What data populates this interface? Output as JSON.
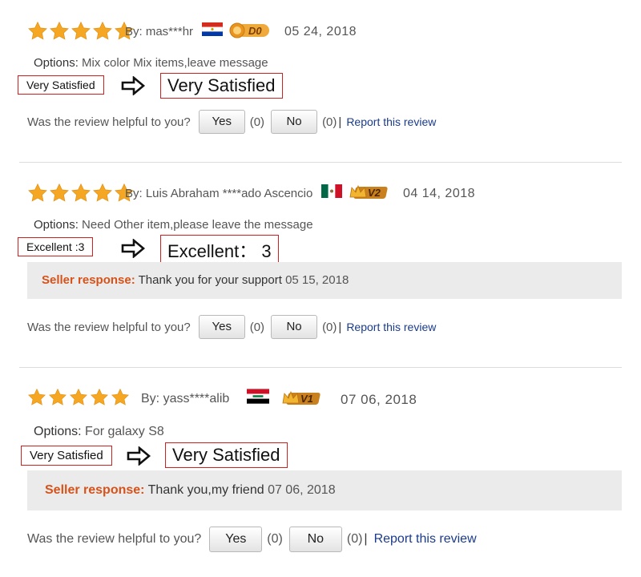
{
  "reviews": [
    {
      "rating": 5,
      "author": "By: mas***hr",
      "level": "D0",
      "date": "05 24, 2018",
      "options_label": "Options:",
      "options_value": "Mix color Mix items,leave message",
      "feedback_original": "Very Satisfied",
      "feedback_translated": "Very Satisfied",
      "helpful_question": "Was the review helpful to you?",
      "yes_label": "Yes",
      "yes_count": "(0)",
      "no_label": "No",
      "no_count": "(0)",
      "separator": "|",
      "report_label": "Report this review"
    },
    {
      "rating": 5,
      "author": "By: Luis Abraham ****ado Ascencio",
      "level": "V2",
      "date": "04 14, 2018",
      "options_label": "Options:",
      "options_value": "Need Other item,please leave the message",
      "feedback_original": "Excellent :3",
      "feedback_translated": "Excellent： 3",
      "seller_label": "Seller response:",
      "seller_text": "Thank you for your support",
      "seller_date": "05 15, 2018",
      "helpful_question": "Was the review helpful to you?",
      "yes_label": "Yes",
      "yes_count": "(0)",
      "no_label": "No",
      "no_count": "(0)",
      "separator": "|",
      "report_label": "Report this review"
    },
    {
      "rating": 5,
      "author": "By: yass****alib",
      "level": "V1",
      "date": "07 06, 2018",
      "options_label": "Options:",
      "options_value": "For galaxy S8",
      "feedback_original": "Very Satisfied",
      "feedback_translated": "Very Satisfied",
      "seller_label": "Seller response:",
      "seller_text": "Thank you,my friend",
      "seller_date": "07 06, 2018",
      "helpful_question": "Was the review helpful to you?",
      "yes_label": "Yes",
      "yes_count": "(0)",
      "no_label": "No",
      "no_count": "(0)",
      "separator": "|",
      "report_label": "Report this review"
    }
  ],
  "colors": {
    "star": "#f5a623",
    "highlight_border": "#d02020",
    "seller_label": "#d5531a",
    "report_link": "#1a3b8c",
    "badge": "#d98a1c"
  },
  "icons": {
    "star": "star-icon",
    "arrow": "arrow-right-icon",
    "flag_1": "paraguay-flag-icon",
    "flag_2": "mexico-flag-icon",
    "flag_3": "iraq-flag-icon",
    "badge_d0": "medal-badge-icon",
    "badge_v": "crown-badge-icon"
  }
}
